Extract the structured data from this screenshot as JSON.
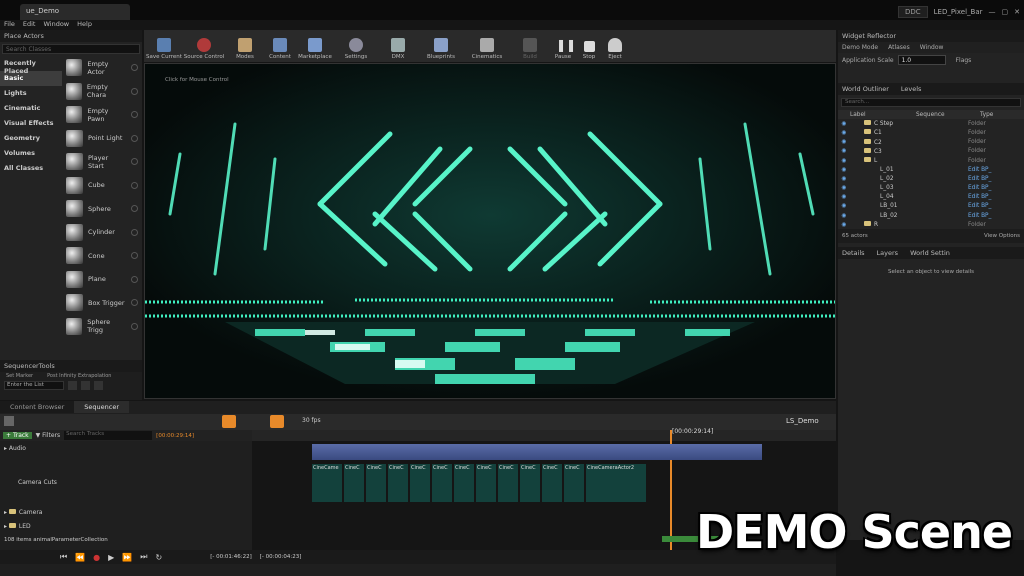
{
  "window": {
    "tab_title": "ue_Demo",
    "project": "LED_Pixel_Bar",
    "ddc": "DDC"
  },
  "menu": [
    "File",
    "Edit",
    "Window",
    "Help"
  ],
  "place_actors": {
    "title": "Place Actors",
    "search_placeholder": "Search Classes",
    "categories": [
      "Recently Placed",
      "Basic",
      "Lights",
      "Cinematic",
      "Visual Effects",
      "Geometry",
      "Volumes",
      "All Classes"
    ],
    "selected_category": "Basic",
    "actors": [
      "Empty Actor",
      "Empty Chara",
      "Empty Pawn",
      "Point Light",
      "Player Start",
      "Cube",
      "Sphere",
      "Cylinder",
      "Cone",
      "Plane",
      "Box Trigger",
      "Sphere Trigg"
    ]
  },
  "sequencer_tools": {
    "title": "SequencerTools",
    "set_marker": "Set Marker",
    "post_infinity": "Post Infinity Extrapolation",
    "enter_list": "Enter the List"
  },
  "toolbar": [
    "Save Current",
    "Source Control",
    "Modes",
    "Content",
    "Marketplace",
    "Settings",
    "DMX",
    "Blueprints",
    "Cinematics",
    "Build",
    "Pause",
    "Stop",
    "Eject"
  ],
  "viewport": {
    "caption": "Click for Mouse Control"
  },
  "widget_reflector": {
    "title": "Widget Reflector",
    "tabs": [
      "Demo Mode",
      "Atlases",
      "Window"
    ],
    "app_scale_label": "Application Scale",
    "app_scale_value": "1.0",
    "flags": "Flags"
  },
  "outliner": {
    "tabs": [
      "World Outliner",
      "Levels"
    ],
    "search_placeholder": "Search...",
    "columns": [
      "Label",
      "Sequence",
      "Type"
    ],
    "rows": [
      {
        "label": "C Step",
        "type": "Folder"
      },
      {
        "label": "C1",
        "type": "Folder"
      },
      {
        "label": "C2",
        "type": "Folder"
      },
      {
        "label": "C3",
        "type": "Folder"
      },
      {
        "label": "L",
        "type": "Folder"
      },
      {
        "label": "L_01",
        "type": "Edit BP_"
      },
      {
        "label": "L_02",
        "type": "Edit BP_"
      },
      {
        "label": "L_03",
        "type": "Edit BP_"
      },
      {
        "label": "L_04",
        "type": "Edit BP_"
      },
      {
        "label": "LB_01",
        "type": "Edit BP_"
      },
      {
        "label": "LB_02",
        "type": "Edit BP_"
      },
      {
        "label": "R",
        "type": "Folder"
      }
    ],
    "count": "65 actors",
    "view_options": "View Options"
  },
  "details": {
    "tabs": [
      "Details",
      "Layers",
      "World Settin"
    ],
    "empty": "Select an object to view details"
  },
  "bottom_tabs": [
    "Content Browser",
    "Sequencer"
  ],
  "sequencer": {
    "track_btn": "Track",
    "filters": "Filters",
    "search": "Search Tracks",
    "time": "[00:00:29:14]",
    "fps": "30 fps",
    "sequence": "LS_Demo",
    "playhead": "[00:00:29:14]",
    "tracks": [
      "Audio",
      "Camera Cuts",
      "Camera",
      "LED"
    ],
    "items": "108 items",
    "param": "animalParameterCollection",
    "range_start": "[- 00:01:46:22]",
    "range_end": "[- 00:00:04:23]",
    "clips": [
      "CineCame",
      "CineC",
      "CineC",
      "CineC",
      "CineC",
      "CineC",
      "CineC",
      "CineC",
      "CineC",
      "CineC",
      "CineC",
      "CineC",
      "CineCameraActor2"
    ]
  },
  "overlay": {
    "demo_scene": "DEMO Scene"
  },
  "colors": {
    "accent": "#e88a2a",
    "led": "#39e6b8",
    "selection": "#2f5a8a"
  }
}
